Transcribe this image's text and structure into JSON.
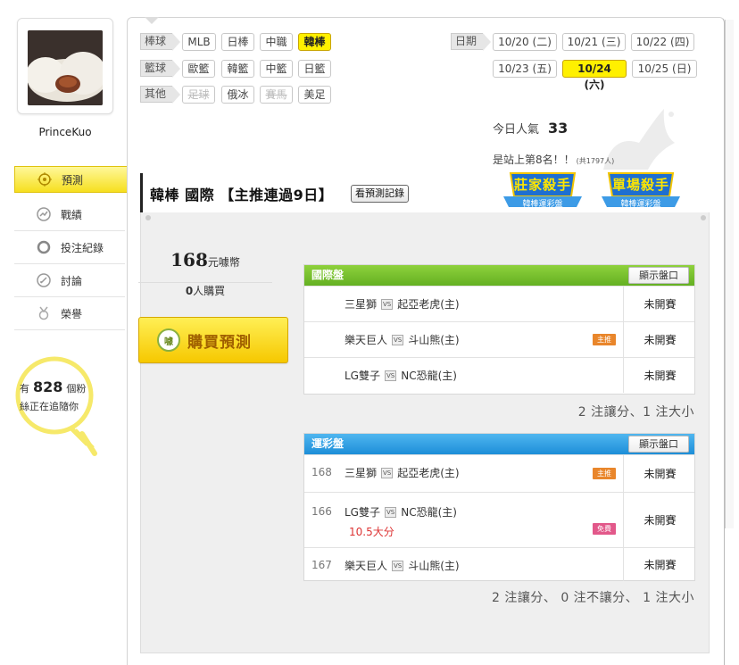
{
  "user": {
    "name": "PrinceKuo"
  },
  "side_nav": [
    {
      "label": "預測",
      "icon": "target-icon",
      "active": true
    },
    {
      "label": "戰績",
      "icon": "chart-icon",
      "active": false
    },
    {
      "label": "投注紀錄",
      "icon": "circle-icon",
      "active": false
    },
    {
      "label": "討論",
      "icon": "chat-icon",
      "active": false
    },
    {
      "label": "榮譽",
      "icon": "medal-icon",
      "active": false
    }
  ],
  "followers": {
    "prefix": "有",
    "count": "828",
    "unit": "個粉",
    "suffix": "絲正在追隨你"
  },
  "categories": [
    {
      "label": "棒球",
      "items": [
        {
          "t": "MLB",
          "s": "normal"
        },
        {
          "t": "日棒",
          "s": "normal"
        },
        {
          "t": "中職",
          "s": "normal"
        },
        {
          "t": "韓棒",
          "s": "active"
        }
      ]
    },
    {
      "label": "籃球",
      "items": [
        {
          "t": "歐籃",
          "s": "normal"
        },
        {
          "t": "韓籃",
          "s": "normal"
        },
        {
          "t": "中籃",
          "s": "normal"
        },
        {
          "t": "日籃",
          "s": "normal"
        }
      ]
    },
    {
      "label": "其他",
      "items": [
        {
          "t": "足球",
          "s": "disabled"
        },
        {
          "t": "俄冰",
          "s": "normal"
        },
        {
          "t": "賽馬",
          "s": "disabled"
        },
        {
          "t": "美足",
          "s": "normal"
        }
      ]
    }
  ],
  "dates": {
    "label": "日期",
    "items": [
      {
        "t": "10/20 (二)",
        "s": "normal"
      },
      {
        "t": "10/21 (三)",
        "s": "normal"
      },
      {
        "t": "10/22 (四)",
        "s": "normal"
      },
      {
        "t": "10/23 (五)",
        "s": "normal"
      },
      {
        "t": "10/24 (六)",
        "s": "active"
      },
      {
        "t": "10/25 (日)",
        "s": "normal"
      }
    ]
  },
  "stats": {
    "popularity_label": "今日人氣",
    "popularity_value": "33",
    "rank_text": "是站上第8名！！",
    "rank_total": "(共1797人)"
  },
  "panel": {
    "title": "韓棒 國際 【主推連過9日】",
    "record_button": "看預測記錄",
    "badges": [
      {
        "main": "莊家殺手",
        "sub": "韓棒運彩盤"
      },
      {
        "main": "單場殺手",
        "sub": "韓棒運彩盤"
      }
    ]
  },
  "purchase": {
    "price": "168",
    "price_unit": "元噱幣",
    "buyers_count": "0",
    "buyers_unit": "人購買",
    "button": "購買預測",
    "coin_label": "噱"
  },
  "intl": {
    "title": "國際盤",
    "show_button": "顯示盤口",
    "rows": [
      {
        "num": "",
        "home": "三星獅",
        "away": "起亞老虎(主)",
        "tag": "",
        "note": "",
        "status": "未開賽"
      },
      {
        "num": "",
        "home": "樂天巨人",
        "away": "斗山熊(主)",
        "tag": "主推",
        "note": "",
        "status": "未開賽"
      },
      {
        "num": "",
        "home": "LG雙子",
        "away": "NC恐龍(主)",
        "tag": "",
        "note": "",
        "status": "未開賽"
      }
    ],
    "summary": "2 注讓分、1 注大小"
  },
  "sport": {
    "title": "運彩盤",
    "show_button": "顯示盤口",
    "rows": [
      {
        "num": "168",
        "home": "三星獅",
        "away": "起亞老虎(主)",
        "tag": "主推",
        "note": "",
        "status": "未開賽"
      },
      {
        "num": "166",
        "home": "LG雙子",
        "away": "NC恐龍(主)",
        "tag": "免費",
        "note": "10.5大分",
        "status": "未開賽"
      },
      {
        "num": "167",
        "home": "樂天巨人",
        "away": "斗山熊(主)",
        "tag": "",
        "note": "",
        "status": "未開賽"
      }
    ],
    "summary": "2 注讓分、 0 注不讓分、 1 注大小"
  },
  "vs_label": "VS",
  "colors": {
    "accent_yellow": "#fff000",
    "green_header": "#6db52a",
    "blue_header": "#2a98de",
    "main_tag": "#e9862b",
    "free_tag": "#e2588a",
    "red_note": "#dd3333"
  }
}
